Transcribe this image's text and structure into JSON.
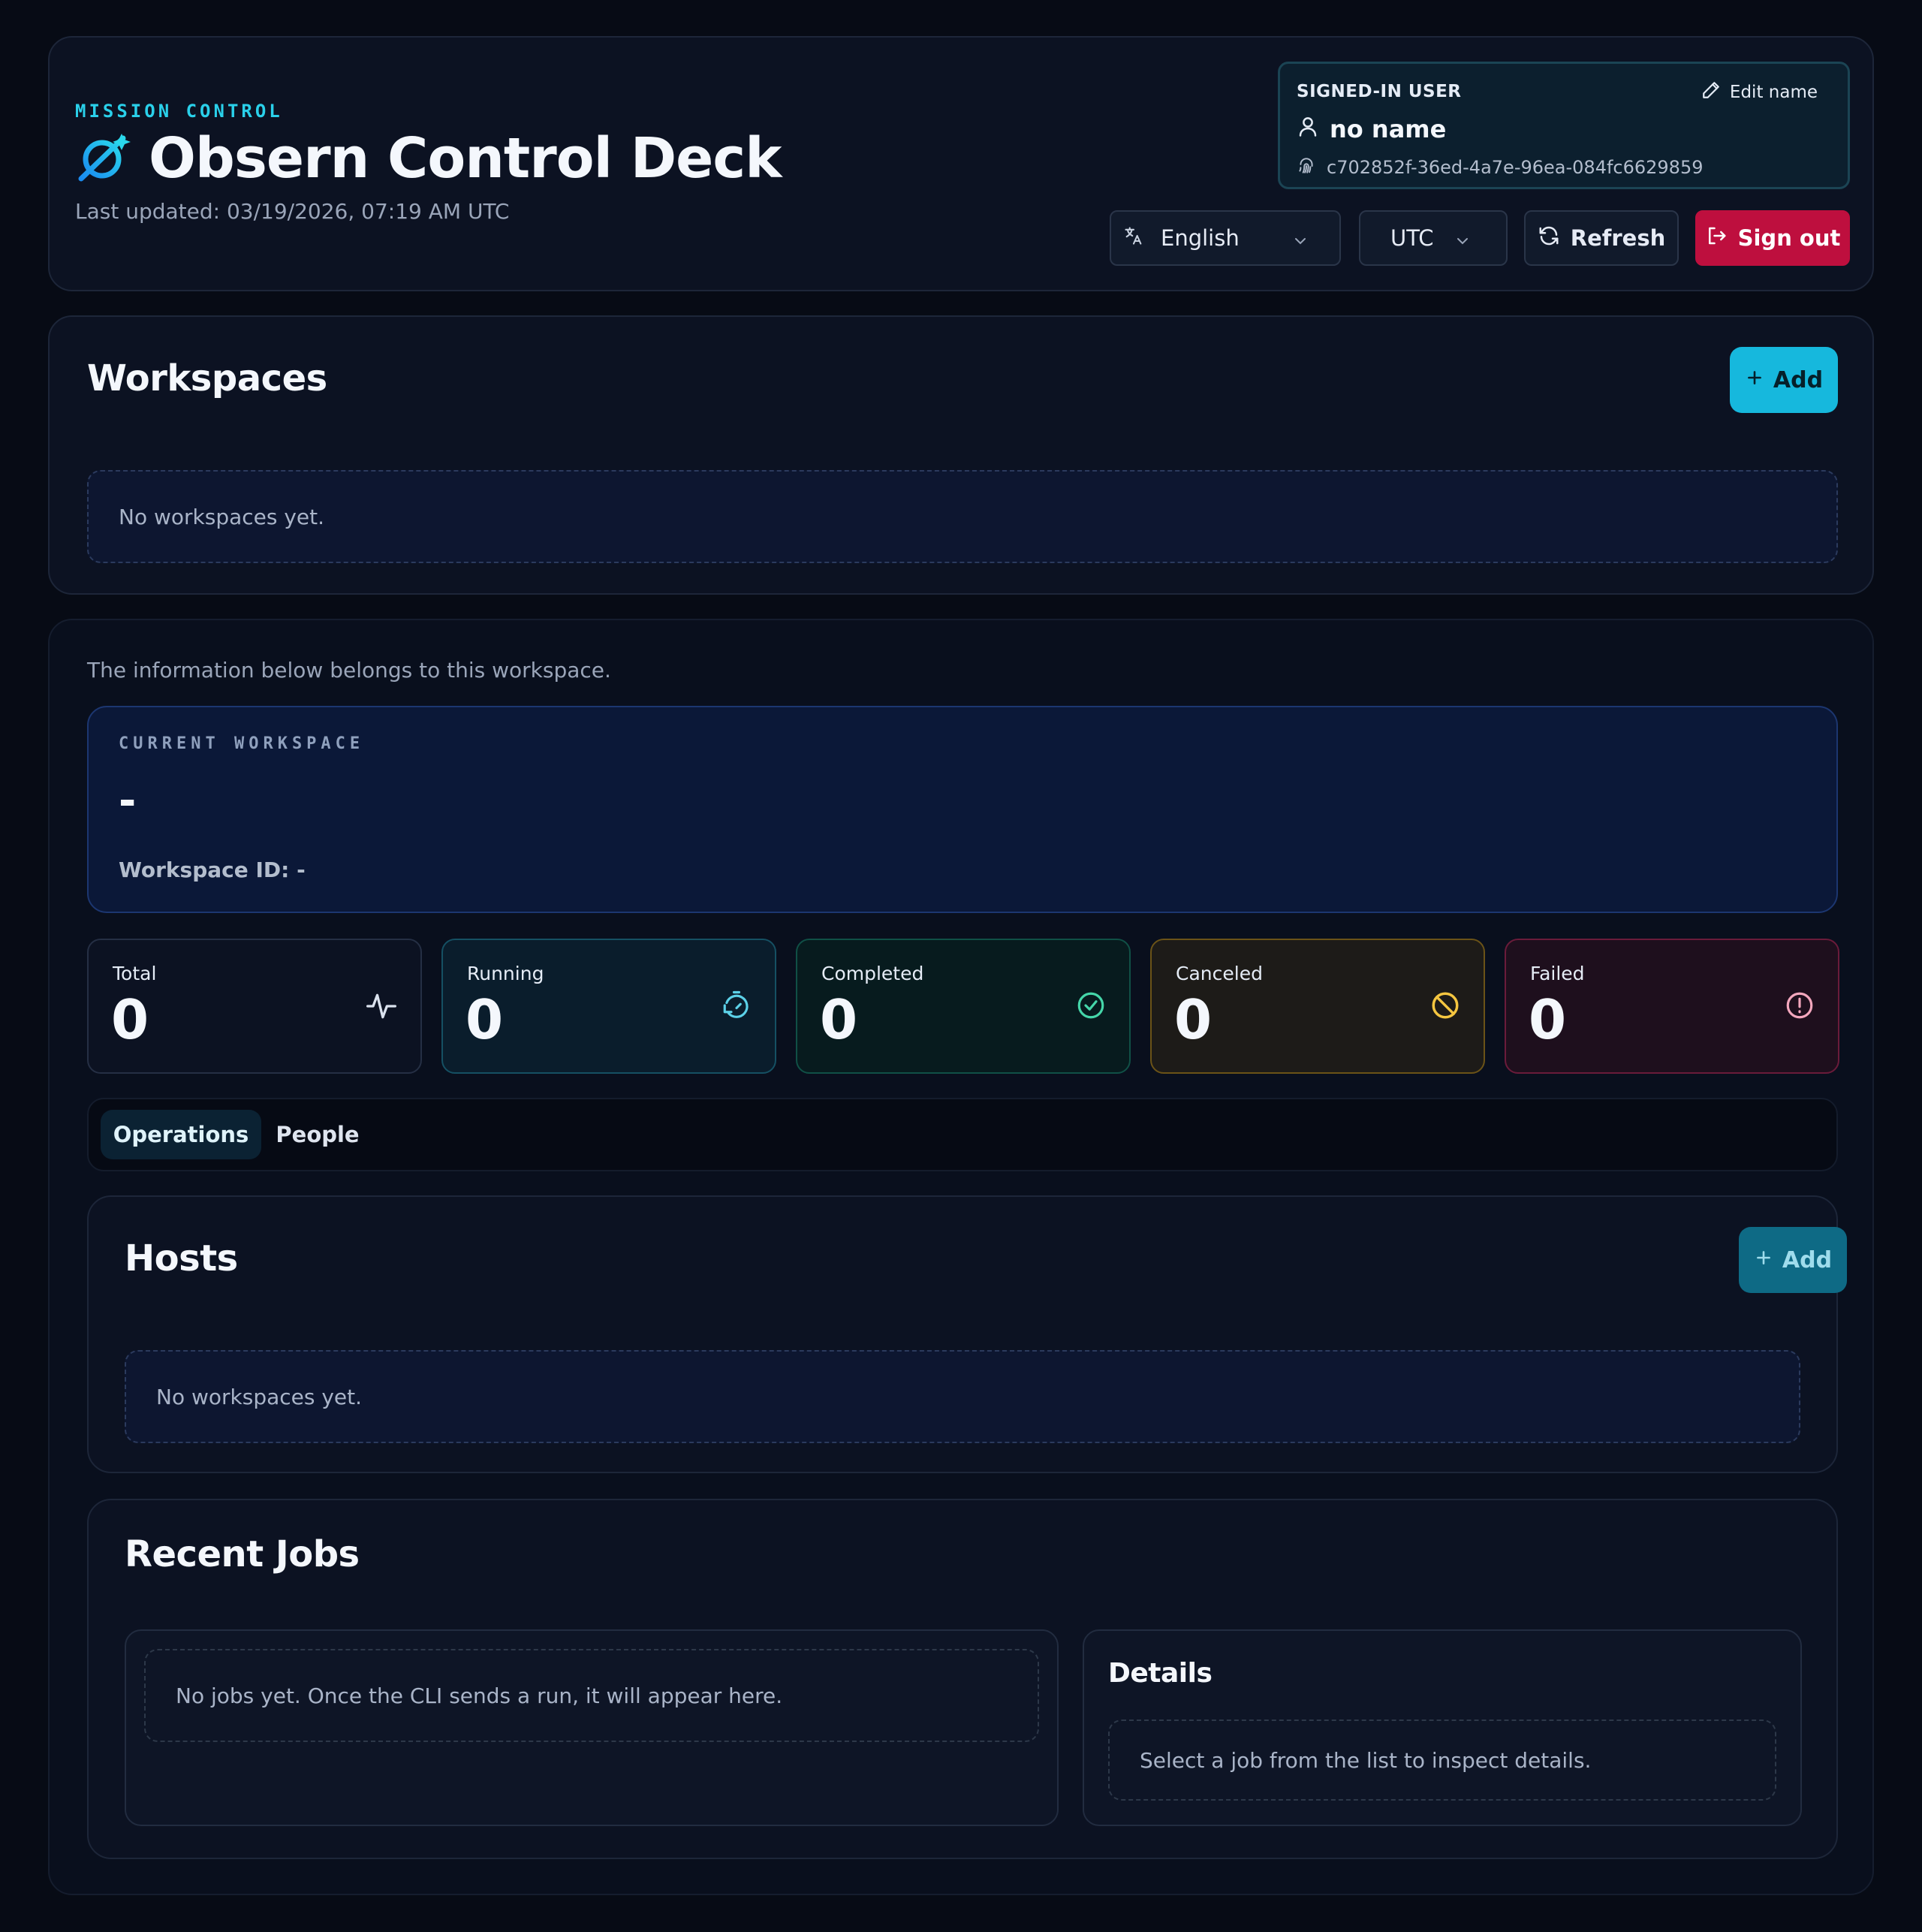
{
  "header": {
    "eyebrow": "MISSION CONTROL",
    "title": "Obsern Control Deck",
    "last_updated": "Last updated: 03/19/2026, 07:19 AM UTC",
    "user": {
      "label": "SIGNED-IN USER",
      "edit_label": "Edit name",
      "name": "no name",
      "id": "c702852f-36ed-4a7e-96ea-084fc6629859"
    },
    "language": "English",
    "timezone": "UTC",
    "refresh_label": "Refresh",
    "signout_label": "Sign out"
  },
  "workspaces": {
    "title": "Workspaces",
    "add_label": "Add",
    "empty_text": "No workspaces yet."
  },
  "detail": {
    "info_text": "The information below belongs to this workspace.",
    "current": {
      "label": "CURRENT WORKSPACE",
      "value": "-",
      "workspace_id": "Workspace ID: -"
    },
    "stats": [
      {
        "label": "Total",
        "value": "0"
      },
      {
        "label": "Running",
        "value": "0"
      },
      {
        "label": "Completed",
        "value": "0"
      },
      {
        "label": "Canceled",
        "value": "0"
      },
      {
        "label": "Failed",
        "value": "0"
      }
    ],
    "tabs": [
      {
        "label": "Operations",
        "active": true
      },
      {
        "label": "People",
        "active": false
      }
    ],
    "hosts": {
      "title": "Hosts",
      "add_label": "Add",
      "empty_text": "No workspaces yet."
    },
    "jobs": {
      "title": "Recent Jobs",
      "empty_text": "No jobs yet. Once the CLI sends a run, it will appear here.",
      "details_title": "Details",
      "details_empty": "Select a job from the list to inspect details."
    }
  },
  "colors": {
    "accent": "#16b8dd",
    "danger": "#be0f3e",
    "background": "#070b15"
  }
}
